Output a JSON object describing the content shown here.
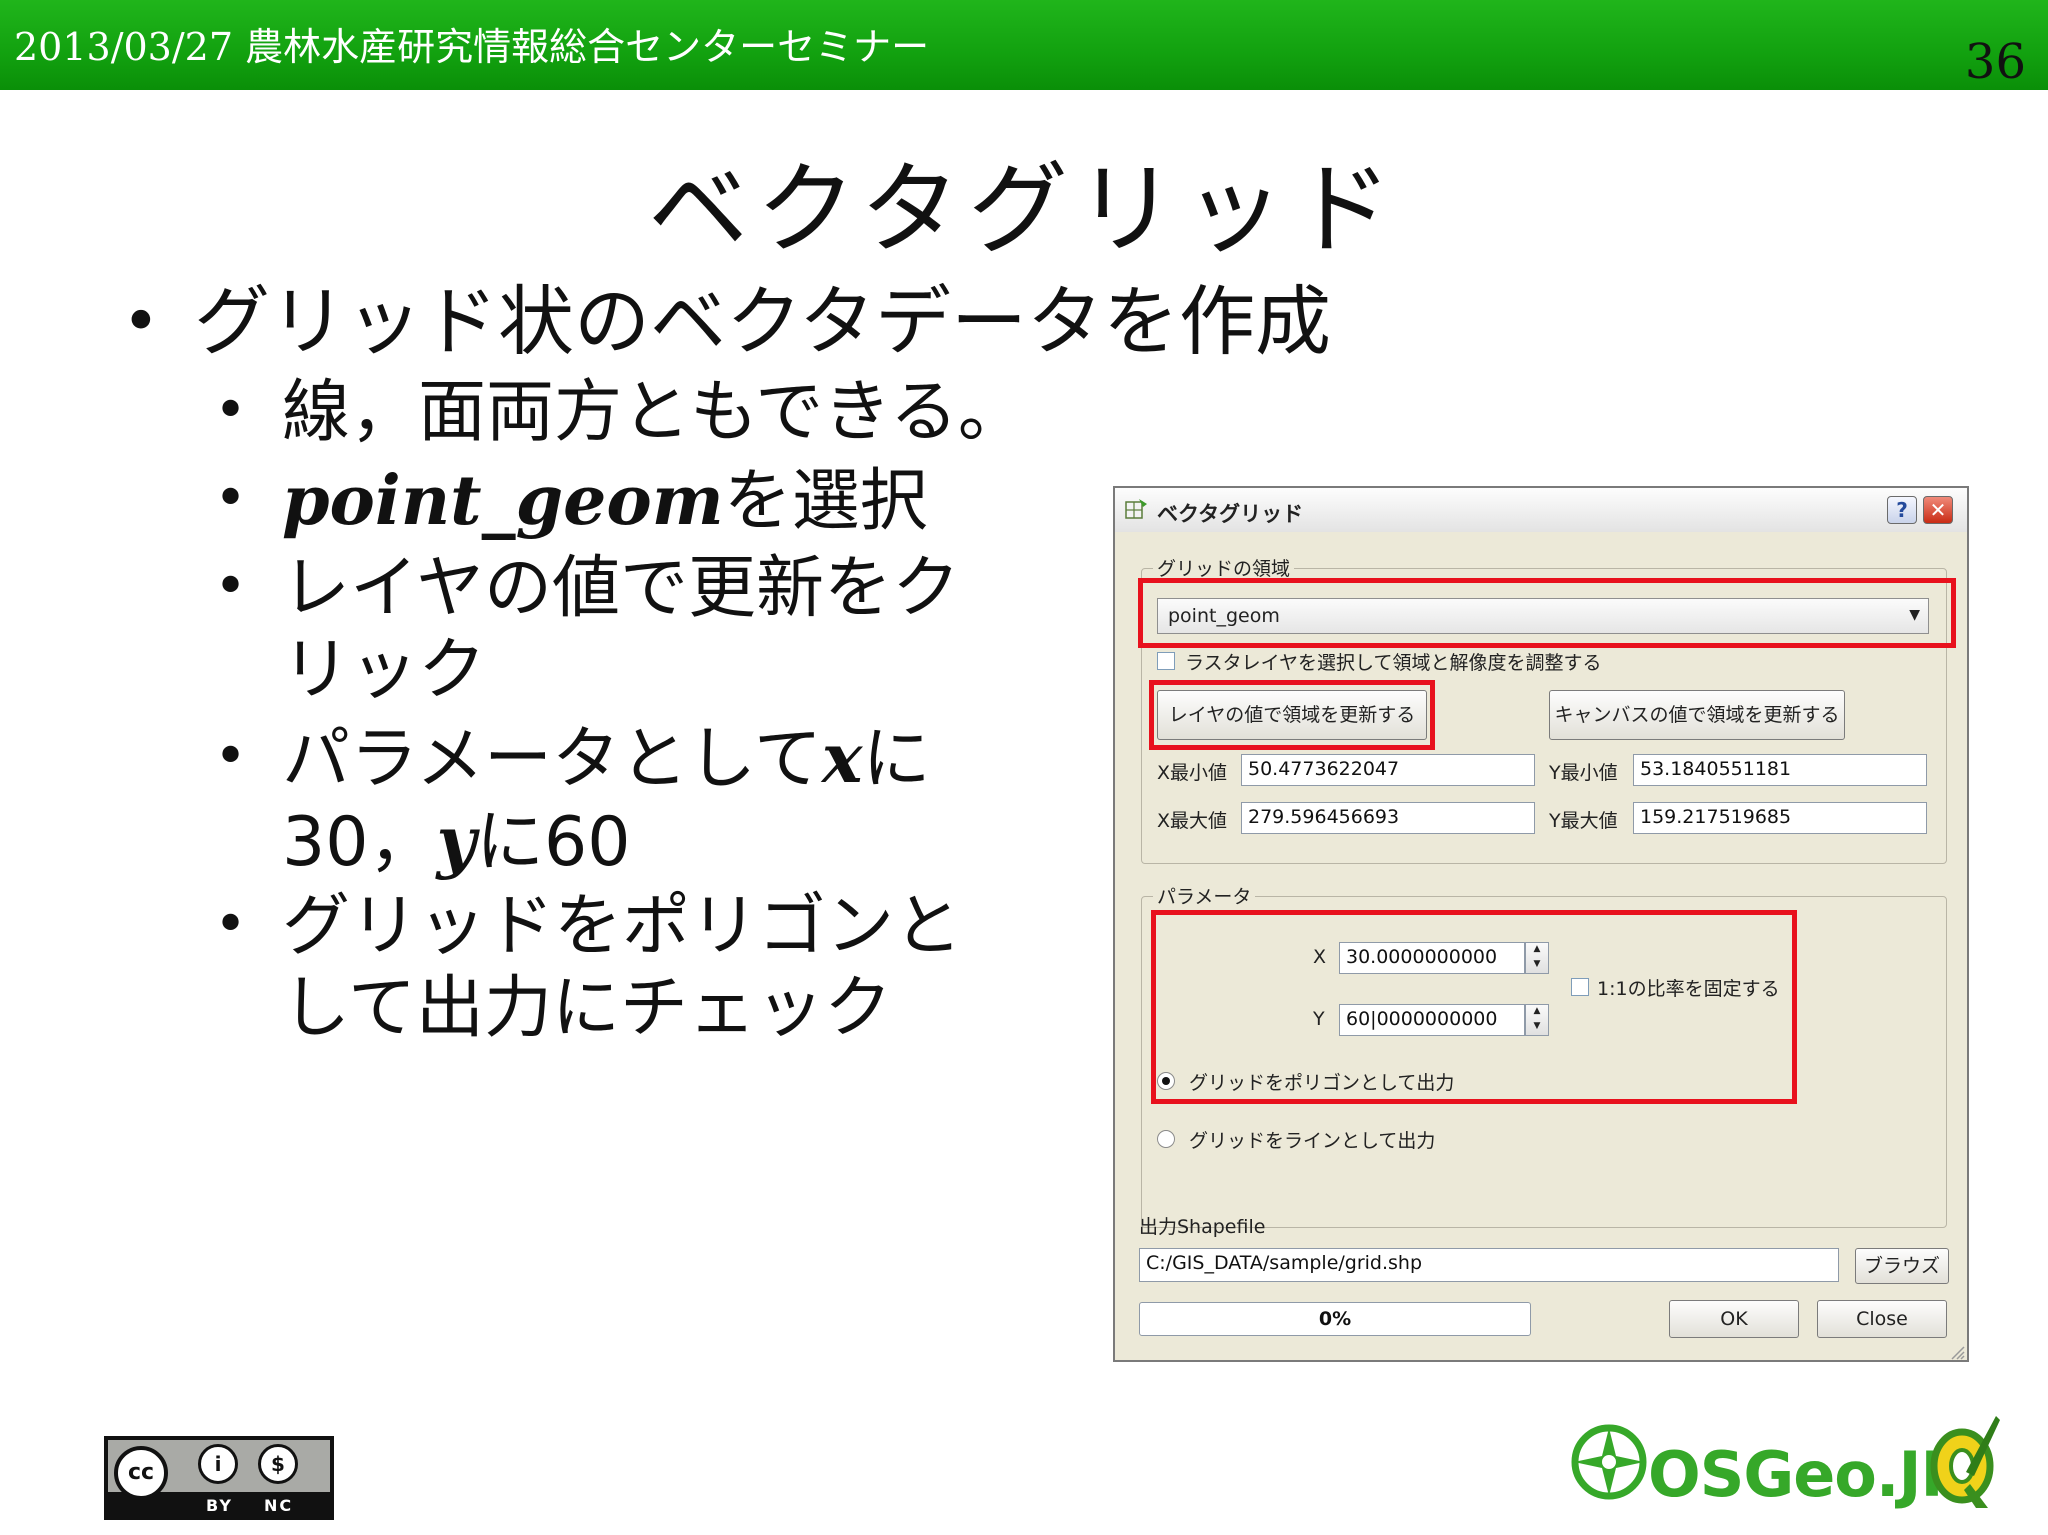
{
  "header": {
    "text": "2013/03/27 農林水産研究情報総合センターセミナー",
    "page_number": "36"
  },
  "slide": {
    "title": "ベクタグリッド",
    "bullet_main": "グリッド状のベクタデータを作成",
    "sub1": "線，面両方ともできる。",
    "sub2_code": "point_geom",
    "sub2_rest": "を選択",
    "sub3_line1": "レイヤの値で更新をク",
    "sub3_line2": "リック",
    "sub4_line1_a": "パラメータとして",
    "sub4_x": "x",
    "sub4_line1_b": "に",
    "sub4_line2_a": "30，",
    "sub4_y": "y",
    "sub4_line2_b": "に60",
    "sub5_line1": "グリッドをポリゴンと",
    "sub5_line2": "して出力にチェック"
  },
  "dialog": {
    "title": "ベクタグリッド",
    "help": "?",
    "close": "✕",
    "extent_group": "グリッドの領域",
    "layer_value": "point_geom",
    "raster_checkbox": "ラスタレイヤを選択して領域と解像度を調整する",
    "update_layer_button": "レイヤの値で領域を更新する",
    "update_canvas_button": "キャンバスの値で領域を更新する",
    "xmin_label": "X最小値",
    "xmin_value": "50.4773622047",
    "ymin_label": "Y最小値",
    "ymin_value": "53.1840551181",
    "xmax_label": "X最大値",
    "xmax_value": "279.596456693",
    "ymax_label": "Y最大値",
    "ymax_value": "159.217519685",
    "param_group": "パラメータ",
    "x_label": "X",
    "x_value": "30.0000000000",
    "y_label": "Y",
    "y_value": "60|0000000000",
    "ratio_checkbox": "1:1の比率を固定する",
    "radio_polygon": "グリッドをポリゴンとして出力",
    "radio_line": "グリッドをラインとして出力",
    "output_label": "出力Shapefile",
    "output_path": "C:/GIS_DATA/sample/grid.shp",
    "browse_button": "ブラウズ",
    "progress_text": "0%",
    "progress_value": 0,
    "ok_button": "OK",
    "close_button": "Close"
  },
  "footer": {
    "cc_symbol": "cc",
    "cc_by": "BY",
    "cc_nc": "NC",
    "osgeo": "OSGeo.JP"
  },
  "colors": {
    "header_green": "#12a10f",
    "highlight_red": "#e8111d",
    "osgeo_green": "#36a829"
  }
}
